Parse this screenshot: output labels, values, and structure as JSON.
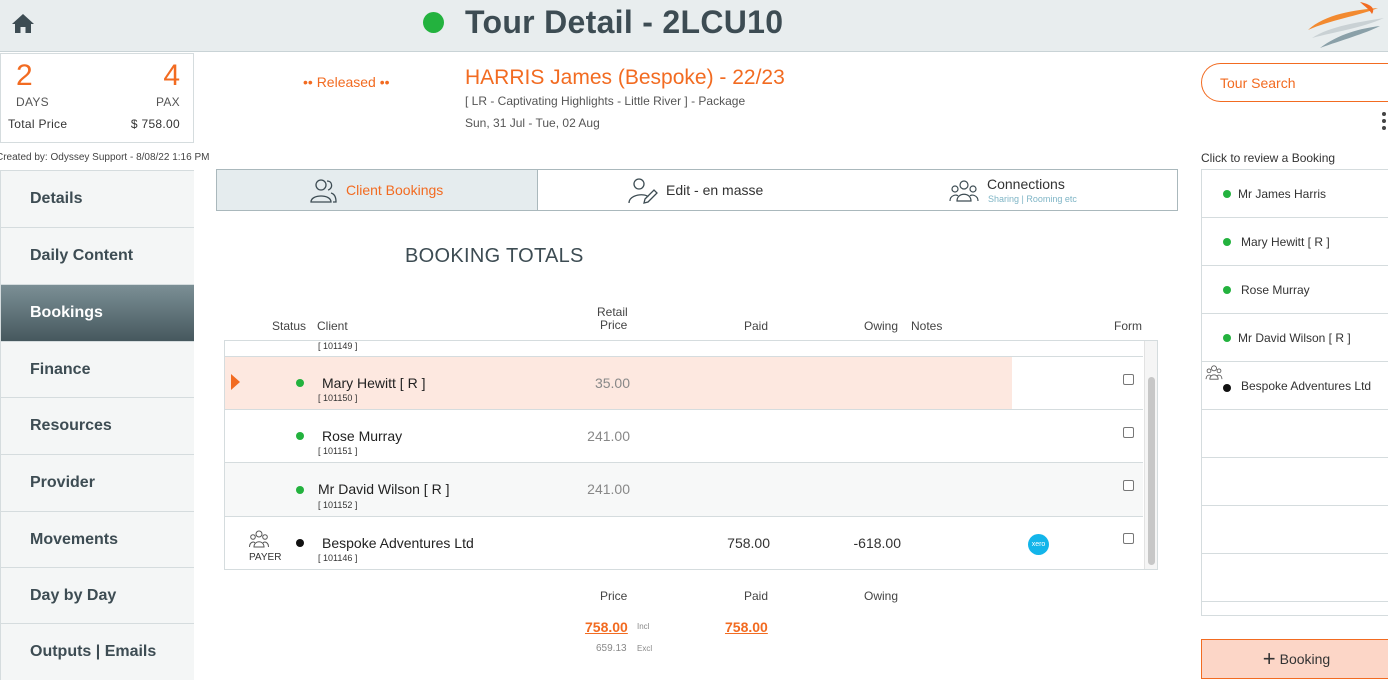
{
  "header": {
    "title": "Tour Detail - 2LCU10",
    "status_color": "#23b23e"
  },
  "summary": {
    "days": "2",
    "days_label": "DAYS",
    "pax": "4",
    "pax_label": "PAX",
    "total_price_label": "Total Price",
    "total_price": "$ 758.00",
    "created_by": "Created by: Odyssey Support - 8/08/22 1:16 PM"
  },
  "tour": {
    "status": "•• Released ••",
    "client_title": "HARRIS James (Bespoke) - 22/23",
    "package": "[ LR - Captivating Highlights - Little River ] - Package",
    "dates": "Sun, 31 Jul  - Tue, 02 Aug"
  },
  "sidebar": {
    "items": [
      {
        "label": "Details"
      },
      {
        "label": "Daily Content"
      },
      {
        "label": "Bookings"
      },
      {
        "label": "Finance"
      },
      {
        "label": "Resources"
      },
      {
        "label": "Provider"
      },
      {
        "label": "Movements"
      },
      {
        "label": "Day by Day"
      },
      {
        "label": "Outputs | Emails"
      }
    ],
    "active_index": 2
  },
  "tabs": {
    "client_bookings": "Client Bookings",
    "edit_en_masse": "Edit - en masse",
    "connections": "Connections",
    "connections_sub": "Sharing | Rooming etc"
  },
  "section_title": "BOOKING TOTALS",
  "table": {
    "headers": {
      "status": "Status",
      "client": "Client",
      "retail_price_1": "Retail",
      "retail_price_2": "Price",
      "paid": "Paid",
      "owing": "Owing",
      "notes": "Notes",
      "form": "Form"
    },
    "partial_row_id": "[ 101149 ]",
    "rows": [
      {
        "name": "Mary Hewitt  [ R ]",
        "id": "[ 101150 ]",
        "retail": "35.00",
        "paid": "",
        "owing": "",
        "status_color": "#23b23e"
      },
      {
        "name": "Rose Murray",
        "id": "[ 101151 ]",
        "retail": "241.00",
        "paid": "",
        "owing": "",
        "status_color": "#23b23e"
      },
      {
        "name": "Mr David Wilson  [ R ]",
        "id": "[ 101152 ]",
        "retail": "241.00",
        "paid": "",
        "owing": "",
        "status_color": "#23b23e"
      },
      {
        "name": "Bespoke Adventures Ltd",
        "id": "[ 101146 ]",
        "retail": "",
        "paid": "758.00",
        "owing": "-618.00",
        "status_color": "#111111",
        "payer_label": "PAYER",
        "badge": "xero"
      }
    ]
  },
  "totals": {
    "price_label": "Price",
    "paid_label": "Paid",
    "owing_label": "Owing",
    "price_incl": "758.00",
    "incl_label": "Incl",
    "price_excl": "659.13",
    "excl_label": "Excl",
    "paid": "758.00"
  },
  "right_panel": {
    "tour_search": "Tour Search",
    "review_label": "Click to review a Booking",
    "review_items": [
      {
        "name": "Mr James Harris",
        "color": "#23b23e"
      },
      {
        "name": "Mary Hewitt  [ R ]",
        "color": "#23b23e"
      },
      {
        "name": "Rose Murray",
        "color": "#23b23e"
      },
      {
        "name": "Mr David Wilson  [ R ]",
        "color": "#23b23e"
      },
      {
        "name": "Bespoke Adventures Ltd",
        "color": "#111111"
      }
    ],
    "add_booking": "Booking"
  },
  "colors": {
    "accent": "#f26b21",
    "active_nav": "#56686e",
    "highlight_row": "#fde8e0",
    "xero": "#13b5ea"
  }
}
